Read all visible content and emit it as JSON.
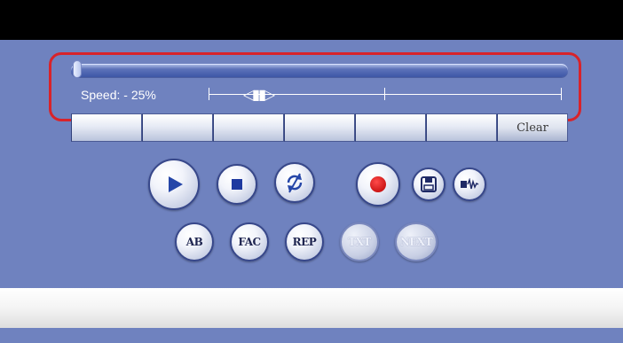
{
  "speed": {
    "label": "Speed: - 25%",
    "thumb_glyph": "◁▮▮▷"
  },
  "seek": {
    "value_fraction": 0.0
  },
  "bookmark_bar": {
    "buttons": [
      "",
      "",
      "",
      "",
      "",
      "",
      "Clear"
    ]
  },
  "transport": {
    "play_icon": "play-icon",
    "stop_icon": "stop-icon",
    "no_sync_icon": "no-sync-icon",
    "record_icon": "record-icon",
    "save_icon": "save-icon",
    "audio_wave_icon": "audio-wave-icon"
  },
  "loop_buttons": {
    "ab": "AB",
    "fac": "FAC",
    "rep": "REP",
    "txt": "TXT",
    "next": "NEXT"
  },
  "colors": {
    "accent_red": "#d8232a",
    "panel_blue": "#6f82bf",
    "play_blue": "#2546a8"
  }
}
